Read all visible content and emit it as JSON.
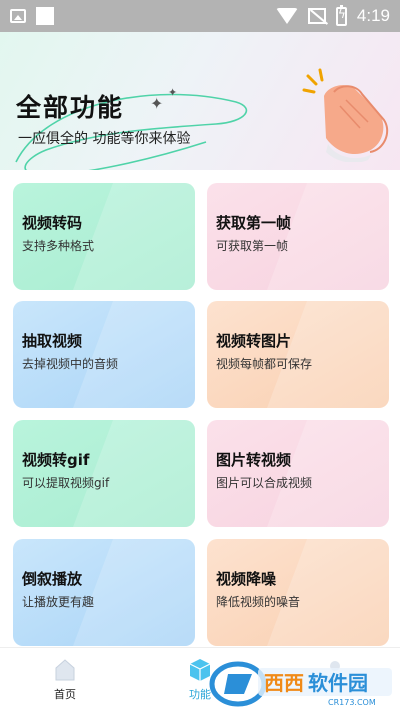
{
  "status_bar": {
    "time": "4:19",
    "icons": [
      "image-icon",
      "blank-square-icon",
      "wifi-icon",
      "no-signal-icon",
      "battery-charging-icon"
    ]
  },
  "header": {
    "title": "全部功能",
    "subtitle": "一应俱全的 功能等你来体验",
    "illustration": "clapping-hands-icon"
  },
  "features": [
    {
      "title": "视频转码",
      "desc": "支持多种格式",
      "color": "#b9f4dc"
    },
    {
      "title": "获取第一帧",
      "desc": "可获取第一帧",
      "color": "#fbe1ea"
    },
    {
      "title": "抽取视频",
      "desc": "去掉视频中的音频",
      "color": "#c9e6fb"
    },
    {
      "title": "视频转图片",
      "desc": "视频每帧都可保存",
      "color": "#fde2cf"
    },
    {
      "title": "视频转gif",
      "desc": "可以提取视频gif",
      "color": "#b9f4dc"
    },
    {
      "title": "图片转视频",
      "desc": "图片可以合成视频",
      "color": "#fbe1ea"
    },
    {
      "title": "倒叙播放",
      "desc": "让播放更有趣",
      "color": "#c9e6fb"
    },
    {
      "title": "视频降噪",
      "desc": "降低视频的噪音",
      "color": "#fde2cf"
    }
  ],
  "bottom_nav": {
    "items": [
      {
        "label": "首页",
        "icon": "home-icon",
        "active": false
      },
      {
        "label": "功能",
        "icon": "cube-icon",
        "active": true
      },
      {
        "label": "",
        "icon": "profile-icon",
        "active": false
      }
    ]
  },
  "watermark": {
    "text": "西西软件园",
    "domain": "CR173.COM",
    "accent": "#2b8fd8"
  }
}
